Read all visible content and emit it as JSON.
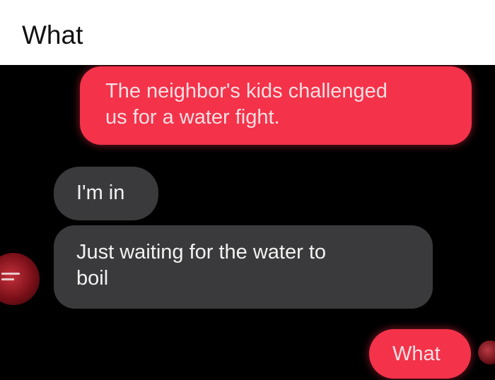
{
  "post": {
    "title": "What"
  },
  "chat": {
    "messages": [
      {
        "side": "sent",
        "lines": [
          "The neighbor's kids challenged",
          "us for a water fight."
        ]
      },
      {
        "side": "received",
        "lines": [
          "I'm in"
        ]
      },
      {
        "side": "received",
        "lines": [
          "Just waiting for the water to",
          "boil"
        ]
      },
      {
        "side": "sent",
        "lines": [
          "What"
        ]
      }
    ]
  },
  "colors": {
    "sent_bubble": "#f4324a",
    "received_bubble": "#3a3a3c",
    "background": "#000000"
  },
  "icons": {
    "contact_avatar": "avatar-icon",
    "read_receipt": "read-receipt-icon"
  }
}
